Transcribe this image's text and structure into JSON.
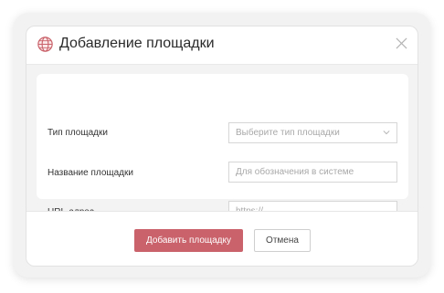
{
  "dialog": {
    "title": "Добавление площадки",
    "icon": "globe-icon"
  },
  "form": {
    "type": {
      "label": "Тип площадки",
      "placeholder": "Выберите тип площадки"
    },
    "name": {
      "label": "Название площадки",
      "placeholder": "Для обозначения в системе"
    },
    "url": {
      "label": "URL-адрес",
      "placeholder": "https://"
    }
  },
  "buttons": {
    "submit": "Добавить площадку",
    "cancel": "Отмена"
  },
  "colors": {
    "accent": "#c9626a",
    "icon": "#c9626a"
  }
}
